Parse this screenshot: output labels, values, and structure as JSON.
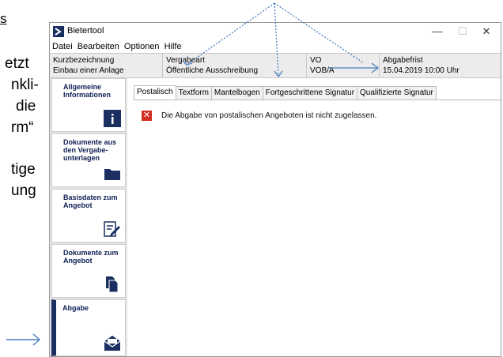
{
  "doc": {
    "top_fragment": "s",
    "lines": [
      "etzt",
      "nkli-",
      "die",
      "rm“",
      "tige",
      "ung"
    ]
  },
  "window": {
    "title": "Bietertool",
    "minimize": "—",
    "maximize": "☐",
    "close": "✕"
  },
  "menu": [
    "Datei",
    "Bearbeiten",
    "Optionen",
    "Hilfe"
  ],
  "info": {
    "kurz_label": "Kurzbezeichnung",
    "kurz_value": "Einbau einer Anlage",
    "vergabe_label": "Vergabeart",
    "vergabe_value": "Öffentliche Ausschreibung",
    "vo_label": "VO",
    "vo_value": "VOB/A",
    "frist_label": "Abgabefrist",
    "frist_value": "15.04.2019 10:00 Uhr"
  },
  "sidebar": [
    {
      "label": "Allgemeine Informationen",
      "icon": "info-icon"
    },
    {
      "label": "Dokumente aus den Vergabe-unterlagen",
      "icon": "folder-icon"
    },
    {
      "label": "Basisdaten zum Angebot",
      "icon": "edit-document-icon"
    },
    {
      "label": "Dokumente zum Angebot",
      "icon": "documents-icon"
    },
    {
      "label": "Abgabe",
      "icon": "envelope-icon"
    }
  ],
  "tabs": [
    "Postalisch",
    "Textform",
    "Mantelbogen",
    "Fortgeschrittene Signatur",
    "Qualifizierte Signatur"
  ],
  "message": "Die Abgabe von postalischen Angeboten ist nicht zugelassen.",
  "colors": {
    "accent": "#1b3060",
    "error": "#d12d20",
    "arrow": "#4a7fc0"
  }
}
